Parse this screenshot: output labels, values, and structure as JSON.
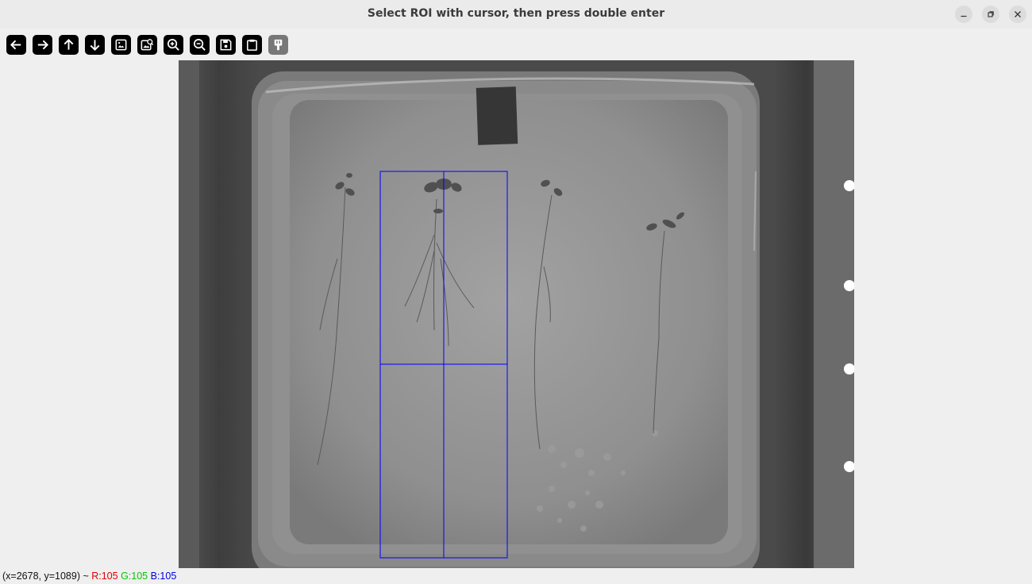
{
  "window": {
    "title": "Select ROI with cursor, then press double enter",
    "controls": [
      {
        "name": "minimize-icon"
      },
      {
        "name": "restore-icon"
      },
      {
        "name": "close-icon"
      }
    ]
  },
  "toolbar": {
    "buttons": [
      {
        "name": "pan-left-icon"
      },
      {
        "name": "pan-right-icon"
      },
      {
        "name": "pan-up-icon"
      },
      {
        "name": "pan-down-icon"
      },
      {
        "name": "zoom-actual-size-icon"
      },
      {
        "name": "zoom-fit-icon"
      },
      {
        "name": "zoom-in-icon"
      },
      {
        "name": "zoom-out-icon"
      },
      {
        "name": "save-icon"
      },
      {
        "name": "copy-clipboard-icon"
      },
      {
        "name": "properties-icon"
      }
    ]
  },
  "image": {
    "description_icon": "plate-image",
    "roi_color": "#0000ff"
  },
  "status": {
    "coords": "(x=2678, y=1089) ~ ",
    "r": "R:105",
    "g": "G:105",
    "b": "B:105"
  }
}
